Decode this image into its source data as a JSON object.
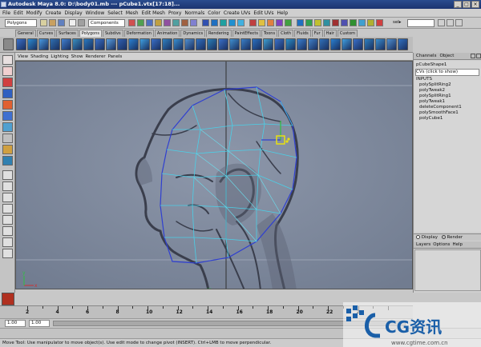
{
  "window": {
    "title": "Autodesk Maya 8.0: D:\\body01.mb  ---  pCube1.vtx[17:18]...",
    "buttons": [
      "_",
      "□",
      "×"
    ]
  },
  "menus": [
    "File",
    "Edit",
    "Modify",
    "Create",
    "Display",
    "Window",
    "Select",
    "Mesh",
    "Edit Mesh",
    "Proxy",
    "Normals",
    "Color",
    "Create UVs",
    "Edit UVs",
    "Help"
  ],
  "status_line": {
    "mode_menu": "Polygons",
    "component_field": "Components",
    "sel_label": "sel▸"
  },
  "shelf": {
    "tabs": [
      "General",
      "Curves",
      "Surfaces",
      "Polygons",
      "Subdivs",
      "Deformation",
      "Animation",
      "Dynamics",
      "Rendering",
      "PaintEffects",
      "Toons",
      "Cloth",
      "Fluids",
      "Fur",
      "Hair",
      "Custom"
    ],
    "active_tab": "Polygons"
  },
  "panel_menu": [
    "View",
    "Shading",
    "Lighting",
    "Show",
    "Renderer",
    "Panels"
  ],
  "viewport": {
    "axis_x": "x",
    "axis_y": "y",
    "center_label": "..."
  },
  "channel_box": {
    "tabs": [
      "Channels",
      "Object"
    ],
    "shape_node": "pCubeShape1",
    "cvs_row": "CVs (click to show)",
    "inputs_header": "INPUTS",
    "inputs": [
      "polySplitRing2",
      "polyTweak2",
      "polySplitRing1",
      "polyTweak1",
      "deleteComponent1",
      "polySmoothFace1",
      "polyCube1"
    ],
    "display_label": "Display",
    "render_label": "Render",
    "layer_menu": [
      "Layers",
      "Options",
      "Help"
    ]
  },
  "time_slider": {
    "labels": [
      "2",
      "4",
      "6",
      "8",
      "10",
      "12",
      "14",
      "16",
      "18",
      "20",
      "22",
      "2"
    ]
  },
  "range_slider": {
    "start": "1.00",
    "end": "1.00"
  },
  "help_line": "Move Tool: Use manipulator to move object(s). Use edit mode to change pivot (INSERT). Ctrl+LMB to move perpendicular.",
  "watermark": {
    "logo": "CG资讯",
    "url": "www.cgtime.com.cn"
  },
  "colors": {
    "title_blue": "#1c3470",
    "viewport_bg": "#7a8598",
    "wire_cyan": "#4ad0e8",
    "wire_blue": "#3040d0",
    "highlight_yellow": "#e8e010"
  }
}
